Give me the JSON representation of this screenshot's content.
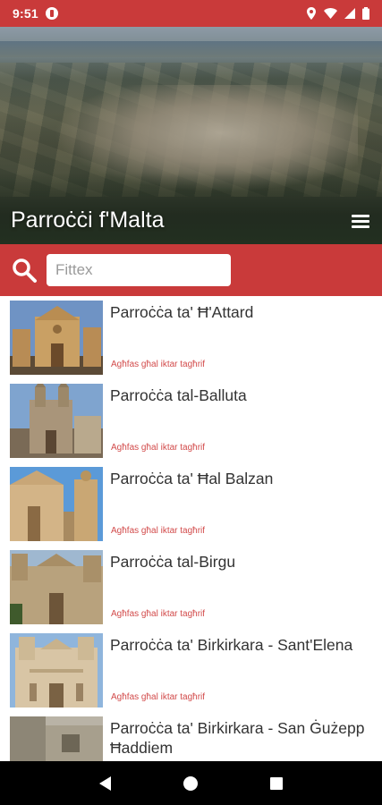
{
  "status_bar": {
    "time": "9:51",
    "icons": [
      "app-notification-icon",
      "location-icon",
      "wifi-icon",
      "cellular-icon",
      "battery-icon"
    ]
  },
  "header": {
    "title": "Parroċċi f'Malta",
    "menu_icon": "hamburger-menu-icon"
  },
  "search": {
    "icon": "search-icon",
    "placeholder": "Fittex",
    "value": ""
  },
  "list": {
    "items": [
      {
        "title": "Parroċċa ta' Ħ'Attard",
        "more": "Agħfas għal iktar tagħrif",
        "thumb_icon": "church-photo-attard"
      },
      {
        "title": "Parroċċa tal-Balluta",
        "more": "Agħfas għal iktar tagħrif",
        "thumb_icon": "church-photo-balluta"
      },
      {
        "title": "Parroċċa ta' Ħal Balzan",
        "more": "Agħfas għal iktar tagħrif",
        "thumb_icon": "church-photo-balzan"
      },
      {
        "title": "Parroċċa tal-Birgu",
        "more": "Agħfas għal iktar tagħrif",
        "thumb_icon": "church-photo-birgu"
      },
      {
        "title": "Parroċċa ta' Birkirkara - Sant'Elena",
        "more": "Agħfas għal iktar tagħrif",
        "thumb_icon": "church-photo-birkirkara"
      },
      {
        "title": "Parroċċa ta' Birkirkara - San Ġużepp Ħaddiem",
        "more": "",
        "thumb_icon": "church-photo-birkirkara-san-guzepp"
      }
    ]
  },
  "colors": {
    "accent": "#c93a3a",
    "link_text": "#d24a4a",
    "title_text": "#333333"
  },
  "nav_bar": {
    "icons": [
      "back-icon",
      "home-icon",
      "recents-icon"
    ]
  }
}
